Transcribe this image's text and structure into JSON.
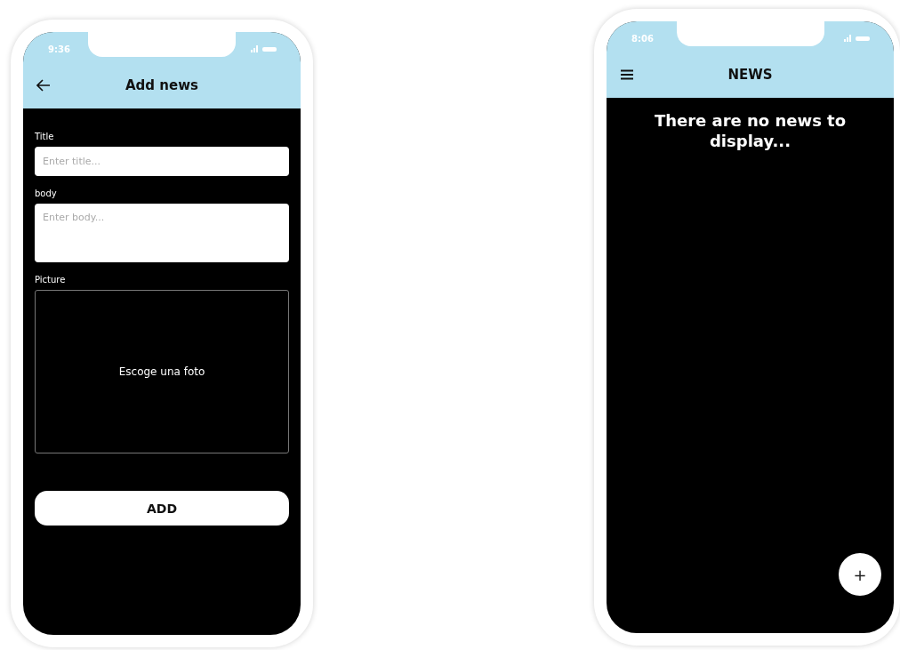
{
  "screens": [
    {
      "kind": "add_form",
      "status_time": "9:36",
      "title": "Add news",
      "fields": [
        {
          "kind": "input",
          "label": "Title",
          "placeholder": "Enter title..."
        },
        {
          "kind": "textarea",
          "label": "body",
          "placeholder": "Enter body..."
        },
        {
          "kind": "picture",
          "label": "Picture",
          "prompt": "Escoge una foto"
        }
      ],
      "button": "ADD"
    },
    {
      "kind": "list",
      "status_time": "8:06",
      "title": "NEWS",
      "empty_message": "There are no news to display...",
      "fab": "+"
    }
  ]
}
